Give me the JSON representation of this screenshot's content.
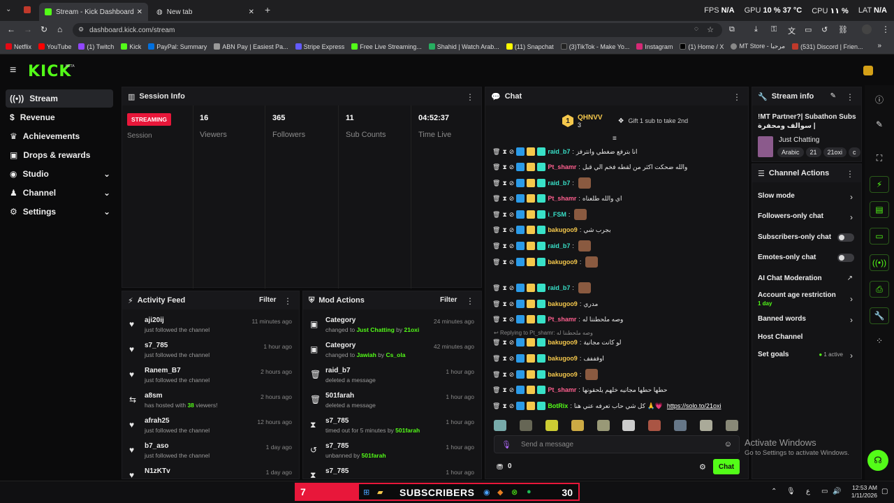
{
  "browser": {
    "tabs": [
      {
        "label": "Stream - Kick Dashboard"
      },
      {
        "label": "New tab"
      }
    ],
    "url": "dashboard.kick.com/stream",
    "stats": {
      "fps_label": "FPS",
      "fps": "N/A",
      "gpu_label": "GPU",
      "gpu": "10 % 37 °C",
      "cpu_label": "CPU",
      "cpu": "١١ %",
      "lat_label": "LAT",
      "lat": "N/A"
    },
    "bookmarks": [
      "Netflix",
      "YouTube",
      "(1) Twitch",
      "Kick",
      "PayPal: Summary",
      "ABN Pay | Easiest Pa...",
      "Stripe Express",
      "Free Live Streaming...",
      "Shahid | Watch Arab...",
      "(11) Snapchat",
      "(3)TikTok - Make Yo...",
      "Instagram",
      "(1) Home / X",
      "MT Store - مرحبا",
      "(531) Discord | Frien..."
    ]
  },
  "header": {
    "logo": "KICK",
    "logo_badge": "BETA"
  },
  "sidebar": {
    "items": [
      {
        "label": "Stream",
        "icon": "stream-icon"
      },
      {
        "label": "Revenue",
        "icon": "dollar-icon"
      },
      {
        "label": "Achievements",
        "icon": "trophy-icon"
      },
      {
        "label": "Drops & rewards",
        "icon": "gift-icon"
      },
      {
        "label": "Studio",
        "icon": "studio-icon"
      },
      {
        "label": "Channel",
        "icon": "person-icon"
      },
      {
        "label": "Settings",
        "icon": "gear-icon"
      }
    ]
  },
  "session": {
    "title": "Session Info",
    "badge": "STREAMING",
    "session_label": "Session",
    "stats": [
      {
        "value": "16",
        "label": "Viewers"
      },
      {
        "value": "365",
        "label": "Followers"
      },
      {
        "value": "11",
        "label": "Sub Counts"
      },
      {
        "value": "04:52:37",
        "label": "Time Live"
      }
    ]
  },
  "activity": {
    "title": "Activity Feed",
    "filter": "Filter",
    "items": [
      {
        "name": "aji20ij",
        "desc": "just followed the channel",
        "time": "11 minutes ago"
      },
      {
        "name": "s7_785",
        "desc": "just followed the channel",
        "time": "1 hour ago"
      },
      {
        "name": "Ranem_B7",
        "desc": "just followed the channel",
        "time": "2 hours ago"
      },
      {
        "name": "a8sm",
        "desc_pre": "has hosted with",
        "desc_num": "38",
        "desc_post": "viewers!",
        "time": "2 hours ago"
      },
      {
        "name": "afrah25",
        "desc": "just followed the channel",
        "time": "12 hours ago"
      },
      {
        "name": "b7_aso",
        "desc": "just followed the channel",
        "time": "1 day ago"
      },
      {
        "name": "N1zKTv",
        "time": "1 day ago"
      }
    ]
  },
  "mod": {
    "title": "Mod Actions",
    "filter": "Filter",
    "items": [
      {
        "name": "Category",
        "pre": "changed to",
        "hl1": "Just Chatting",
        "mid": "by",
        "hl2": "21oxi",
        "time": "24 minutes ago"
      },
      {
        "name": "Category",
        "pre": "changed to",
        "hl1": "Jawiah",
        "mid": "by",
        "hl2": "Cs_ola",
        "time": "42 minutes ago"
      },
      {
        "name": "raid_b7",
        "pre": "deleted a message",
        "time": "1 hour ago"
      },
      {
        "name": "501farah",
        "pre": "deleted a message",
        "time": "1 hour ago"
      },
      {
        "name": "s7_785",
        "pre": "timed out for 5 minutes by",
        "hl2": "501farah",
        "time": "1 hour ago"
      },
      {
        "name": "s7_785",
        "pre": "unbanned by",
        "hl2": "501farah",
        "time": "1 hour ago"
      },
      {
        "name": "s7_785",
        "time": "1 hour ago"
      }
    ]
  },
  "chat": {
    "title": "Chat",
    "top_user": "QHNVV",
    "top_count": "3",
    "gift_text": "Gift 1 sub to take 2nd",
    "replying": "Replying to Pt_shamr:",
    "replying_msg": "وصه ملحطننا له",
    "messages": [
      {
        "user": "raid_b7",
        "color": "#38e1c8",
        "text": "انا بترفع ضغطي وانترفز"
      },
      {
        "user": "Pt_shamr",
        "color": "#ff5f8f",
        "text": "والله ضحكت اكثر من لقطه فخم الي قبل"
      },
      {
        "user": "raid_b7",
        "color": "#38e1c8",
        "text": ""
      },
      {
        "user": "Pt_shamr",
        "color": "#ff5f8f",
        "text": "اي والله طلعناه"
      },
      {
        "user": "i_FSM",
        "color": "#38e1c8",
        "text": ""
      },
      {
        "user": "bakugoo9",
        "color": "#f5c84c",
        "text": "بجرب شي"
      },
      {
        "user": "raid_b7",
        "color": "#38e1c8",
        "text": ""
      },
      {
        "user": "bakugoo9",
        "color": "#f5c84c",
        "text": ""
      },
      {
        "user": "raid_b7",
        "color": "#38e1c8",
        "text": ""
      },
      {
        "user": "bakugoo9",
        "color": "#f5c84c",
        "text": "مدري"
      },
      {
        "user": "Pt_shamr",
        "color": "#ff5f8f",
        "text": "وصه ملحطننا له"
      },
      {
        "user": "bakugoo9",
        "color": "#f5c84c",
        "text": "لو كانت مجانية"
      },
      {
        "user": "bakugoo9",
        "color": "#f5c84c",
        "text": "اوفففف"
      },
      {
        "user": "bakugoo9",
        "color": "#f5c84c",
        "text": ""
      },
      {
        "user": "Pt_shamr",
        "color": "#ff5f8f",
        "text": "حطها حطها مجانيه خلهم يلحقونها"
      },
      {
        "user": "BotRix",
        "color": "#53fc18",
        "text": "كل شي حاب تعرفه عني هنا 🙏💗",
        "link": "https://solo.to/21oxi"
      }
    ],
    "input_placeholder": "Send a message",
    "points": "0",
    "send_label": "Chat"
  },
  "streaminfo": {
    "title": "Stream info",
    "stream_title": "!MT Partner?| Subathon Subs سوالف ومحفرة |",
    "category": "Just Chatting",
    "tags": [
      "Arabic",
      "21",
      "21oxi",
      "c"
    ]
  },
  "channel_actions": {
    "title": "Channel Actions",
    "items": [
      {
        "label": "Slow mode",
        "kind": "arrow"
      },
      {
        "label": "Followers-only chat",
        "kind": "arrow"
      },
      {
        "label": "Subscribers-only chat",
        "kind": "toggle"
      },
      {
        "label": "Emotes-only chat",
        "kind": "toggle"
      },
      {
        "label": "AI Chat Moderation",
        "kind": "external"
      },
      {
        "label": "Account age restriction",
        "sub": "1 day",
        "kind": "arrow"
      },
      {
        "label": "Banned words",
        "kind": "arrow"
      },
      {
        "label": "Host Channel",
        "kind": "none"
      },
      {
        "label": "Set goals",
        "badge": "1 active",
        "kind": "arrow"
      }
    ]
  },
  "overlay": {
    "activate_title": "Activate Windows",
    "activate_sub": "Go to Settings to activate Windows."
  },
  "taskbar": {
    "sub_count": "7",
    "sub_label": "SUBSCRIBERS",
    "sub_goal": "30",
    "time": "12:53 AM",
    "date": "1/11/2026",
    "lang": "ع"
  },
  "colors": {
    "accent": "#53fc18",
    "streaming": "#e8173a",
    "bg": "#0b0b0c"
  }
}
